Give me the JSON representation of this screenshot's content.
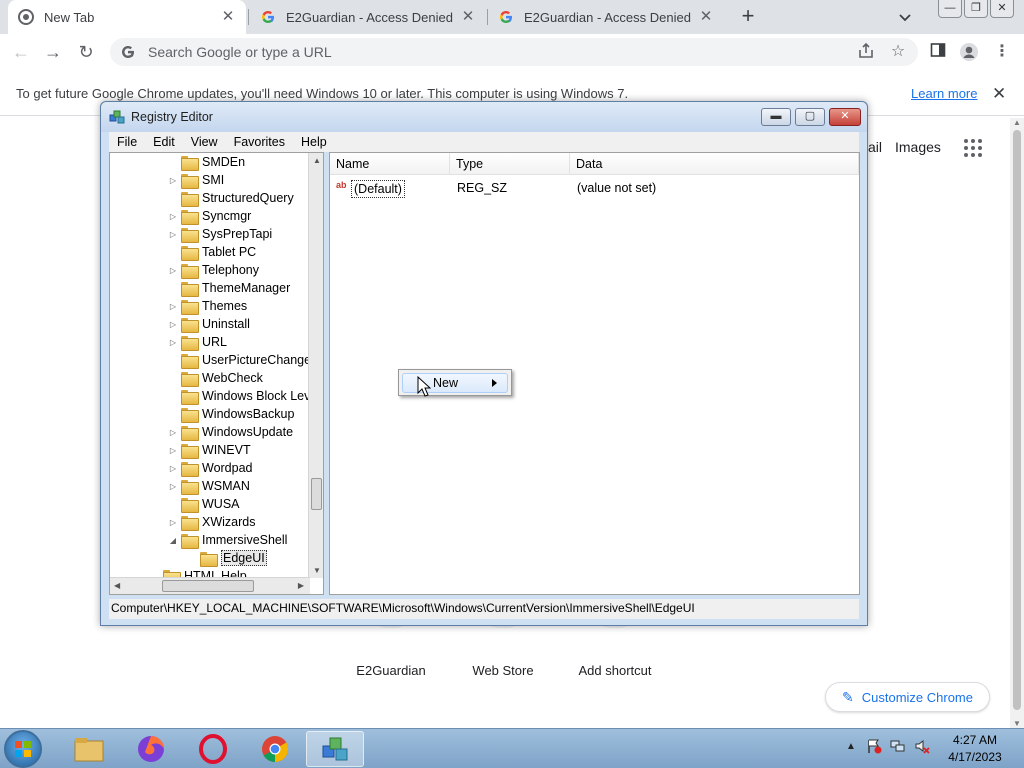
{
  "browser": {
    "tabs": [
      {
        "title": "New Tab",
        "active": true
      },
      {
        "title": "E2Guardian - Access Denied",
        "active": false
      },
      {
        "title": "E2Guardian - Access Denied",
        "active": false
      }
    ],
    "omnibox_placeholder": "Search Google or type a URL",
    "infobar_text": "To get future Google Chrome updates, you'll need Windows 10 or later. This computer is using Windows 7.",
    "infobar_link": "Learn more"
  },
  "newtab": {
    "gmail_label": "ail",
    "images_label": "Images",
    "shortcuts": [
      {
        "label": "E2Guardian"
      },
      {
        "label": "Web Store"
      },
      {
        "label": "Add shortcut"
      }
    ],
    "customize_label": "Customize Chrome"
  },
  "regedit": {
    "title": "Registry Editor",
    "menu": [
      "File",
      "Edit",
      "View",
      "Favorites",
      "Help"
    ],
    "tree": [
      {
        "label": "SMDEn",
        "expander": ""
      },
      {
        "label": "SMI",
        "expander": "▷"
      },
      {
        "label": "StructuredQuery",
        "expander": ""
      },
      {
        "label": "Syncmgr",
        "expander": "▷"
      },
      {
        "label": "SysPrepTapi",
        "expander": "▷"
      },
      {
        "label": "Tablet PC",
        "expander": ""
      },
      {
        "label": "Telephony",
        "expander": "▷"
      },
      {
        "label": "ThemeManager",
        "expander": ""
      },
      {
        "label": "Themes",
        "expander": "▷"
      },
      {
        "label": "Uninstall",
        "expander": "▷"
      },
      {
        "label": "URL",
        "expander": "▷"
      },
      {
        "label": "UserPictureChange",
        "expander": ""
      },
      {
        "label": "WebCheck",
        "expander": ""
      },
      {
        "label": "Windows Block Lev",
        "expander": ""
      },
      {
        "label": "WindowsBackup",
        "expander": ""
      },
      {
        "label": "WindowsUpdate",
        "expander": "▷"
      },
      {
        "label": "WINEVT",
        "expander": "▷"
      },
      {
        "label": "Wordpad",
        "expander": "▷"
      },
      {
        "label": "WSMAN",
        "expander": "▷"
      },
      {
        "label": "WUSA",
        "expander": ""
      },
      {
        "label": "XWizards",
        "expander": "▷"
      },
      {
        "label": "ImmersiveShell",
        "expander": "◢"
      },
      {
        "label": "EdgeUI",
        "expander": ""
      },
      {
        "label": "HTML Help",
        "expander": ""
      }
    ],
    "columns": [
      "Name",
      "Type",
      "Data"
    ],
    "values": [
      {
        "name": "(Default)",
        "type": "REG_SZ",
        "data": "(value not set)"
      }
    ],
    "status_path": "Computer\\HKEY_LOCAL_MACHINE\\SOFTWARE\\Microsoft\\Windows\\CurrentVersion\\ImmersiveShell\\EdgeUI"
  },
  "context_menu": {
    "items": [
      {
        "label": "New",
        "has_submenu": true
      }
    ]
  },
  "taskbar": {
    "time": "4:27 AM",
    "date": "4/17/2023"
  },
  "colors": {
    "chrome_accent": "#1a73e8",
    "taskbar": "#8fb0d3",
    "regedit_frame": "#cfe0f3"
  }
}
